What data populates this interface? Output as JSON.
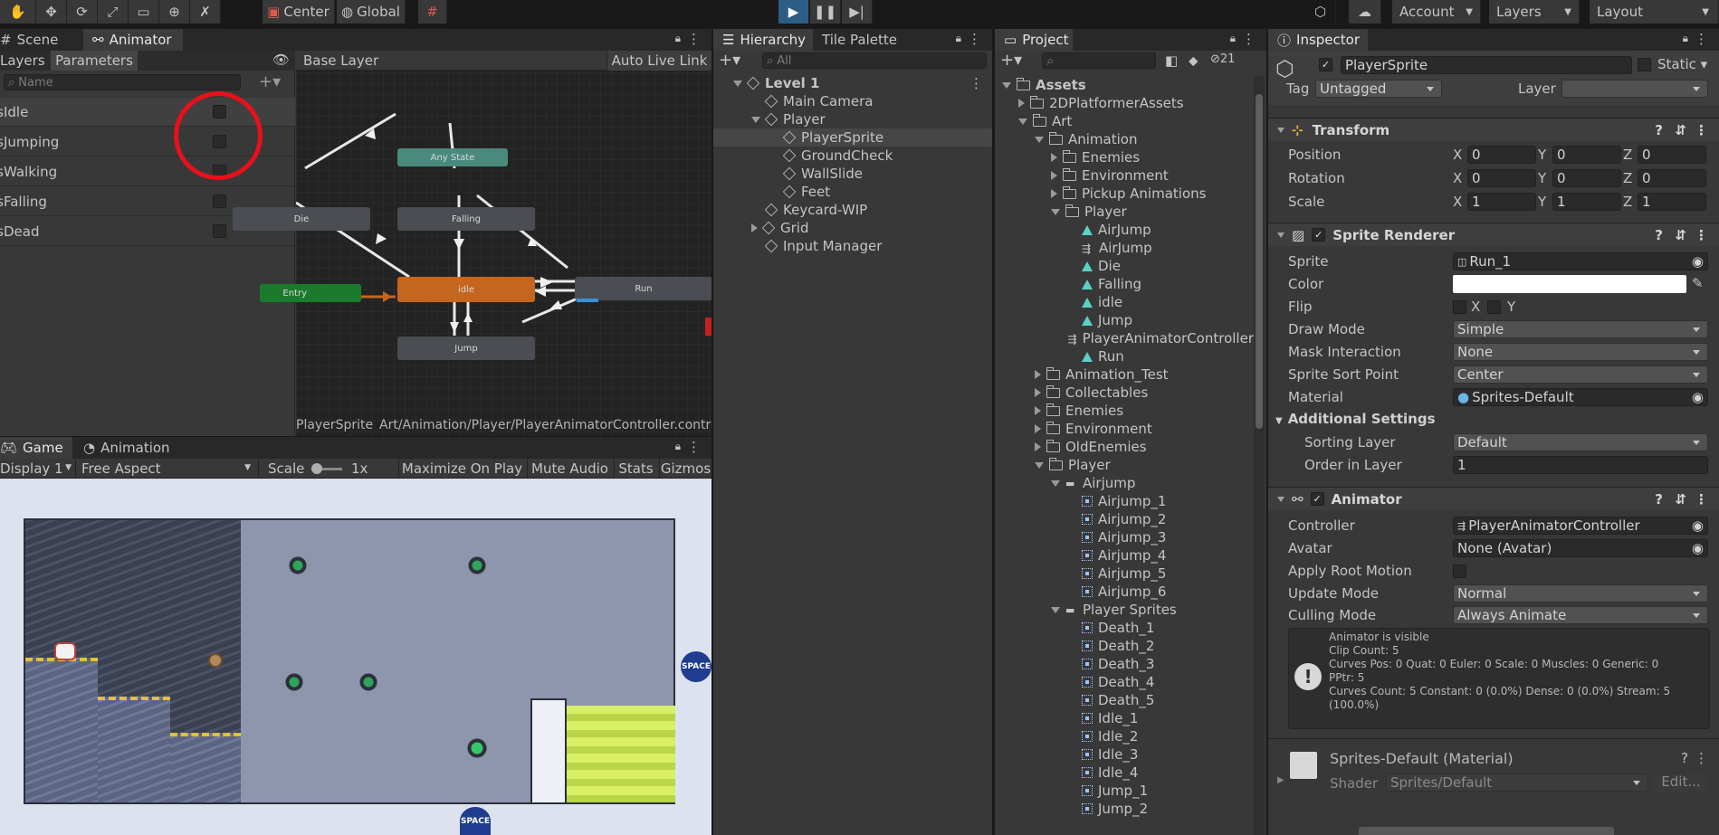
{
  "toolbar": {
    "center_label": "Center",
    "global_label": "Global",
    "account_label": "Account",
    "layers_label": "Layers",
    "layout_label": "Layout"
  },
  "animator": {
    "tab_scene": "Scene",
    "tab_animator": "Animator",
    "tab_layers": "Layers",
    "tab_parameters": "Parameters",
    "base_layer": "Base Layer",
    "auto_live_link": "Auto Live Link",
    "search_placeholder": "Name",
    "params": [
      "isIdle",
      "isJumping",
      "isWalking",
      "isFalling",
      "isDead"
    ],
    "states": {
      "any": "Any State",
      "falling": "Falling",
      "die": "Die",
      "idle": "idle",
      "run": "Run",
      "jump": "Jump",
      "entry": "Entry"
    },
    "footer_object": "PlayerSprite",
    "footer_path": "Art/Animation/Player/PlayerAnimatorController.controller"
  },
  "game": {
    "tab_game": "Game",
    "tab_animation": "Animation",
    "display": "Display 1",
    "aspect": "Free Aspect",
    "scale_label": "Scale",
    "scale_value": "1x",
    "maximize": "Maximize On Play",
    "mute": "Mute Audio",
    "stats": "Stats",
    "gizmos": "Gizmos",
    "space_badge": "SPACE"
  },
  "hierarchy": {
    "tab": "Hierarchy",
    "tab2": "Tile Palette",
    "search_placeholder": "All",
    "items": [
      {
        "label": "Level 1",
        "indent": 0,
        "bold": true
      },
      {
        "label": "Main Camera",
        "indent": 1
      },
      {
        "label": "Player",
        "indent": 1
      },
      {
        "label": "PlayerSprite",
        "indent": 2,
        "selected": true
      },
      {
        "label": "GroundCheck",
        "indent": 2
      },
      {
        "label": "WallSlide",
        "indent": 2
      },
      {
        "label": "Feet",
        "indent": 2
      },
      {
        "label": "Keycard-WIP",
        "indent": 1
      },
      {
        "label": "Grid",
        "indent": 1
      },
      {
        "label": "Input Manager",
        "indent": 1
      }
    ]
  },
  "project": {
    "tab": "Project",
    "badge_count": "21",
    "items": [
      {
        "label": "Assets",
        "indent": 0,
        "type": "folder",
        "open": true,
        "bold": true
      },
      {
        "label": "2DPlatformerAssets",
        "indent": 1,
        "type": "folder"
      },
      {
        "label": "Art",
        "indent": 1,
        "type": "folder",
        "open": true
      },
      {
        "label": "Animation",
        "indent": 2,
        "type": "folder",
        "open": true
      },
      {
        "label": "Enemies",
        "indent": 3,
        "type": "folder"
      },
      {
        "label": "Environment",
        "indent": 3,
        "type": "folder"
      },
      {
        "label": "Pickup Animations",
        "indent": 3,
        "type": "folder"
      },
      {
        "label": "Player",
        "indent": 3,
        "type": "folder",
        "open": true
      },
      {
        "label": "AirJump",
        "indent": 4,
        "type": "clip"
      },
      {
        "label": "AirJump",
        "indent": 4,
        "type": "ctrl"
      },
      {
        "label": "Die",
        "indent": 4,
        "type": "clip"
      },
      {
        "label": "Falling",
        "indent": 4,
        "type": "clip"
      },
      {
        "label": "idle",
        "indent": 4,
        "type": "clip"
      },
      {
        "label": "Jump",
        "indent": 4,
        "type": "clip"
      },
      {
        "label": "PlayerAnimatorController",
        "indent": 4,
        "type": "ctrl"
      },
      {
        "label": "Run",
        "indent": 4,
        "type": "clip"
      },
      {
        "label": "Animation_Test",
        "indent": 2,
        "type": "folder"
      },
      {
        "label": "Collectables",
        "indent": 2,
        "type": "folder"
      },
      {
        "label": "Enemies",
        "indent": 2,
        "type": "folder"
      },
      {
        "label": "Environment",
        "indent": 2,
        "type": "folder"
      },
      {
        "label": "OldEnemies",
        "indent": 2,
        "type": "folder"
      },
      {
        "label": "Player",
        "indent": 2,
        "type": "folder",
        "open": true
      },
      {
        "label": "Airjump",
        "indent": 3,
        "type": "sheet",
        "open": true
      },
      {
        "label": "Airjump_1",
        "indent": 4,
        "type": "frame"
      },
      {
        "label": "Airjump_2",
        "indent": 4,
        "type": "frame"
      },
      {
        "label": "Airjump_3",
        "indent": 4,
        "type": "frame"
      },
      {
        "label": "Airjump_4",
        "indent": 4,
        "type": "frame"
      },
      {
        "label": "Airjump_5",
        "indent": 4,
        "type": "frame"
      },
      {
        "label": "Airjump_6",
        "indent": 4,
        "type": "frame"
      },
      {
        "label": "Player Sprites",
        "indent": 3,
        "type": "sheet",
        "open": true
      },
      {
        "label": "Death_1",
        "indent": 4,
        "type": "frame"
      },
      {
        "label": "Death_2",
        "indent": 4,
        "type": "frame"
      },
      {
        "label": "Death_3",
        "indent": 4,
        "type": "frame"
      },
      {
        "label": "Death_4",
        "indent": 4,
        "type": "frame"
      },
      {
        "label": "Death_5",
        "indent": 4,
        "type": "frame"
      },
      {
        "label": "Idle_1",
        "indent": 4,
        "type": "frame"
      },
      {
        "label": "Idle_2",
        "indent": 4,
        "type": "frame"
      },
      {
        "label": "Idle_3",
        "indent": 4,
        "type": "frame"
      },
      {
        "label": "Idle_4",
        "indent": 4,
        "type": "frame"
      },
      {
        "label": "Jump_1",
        "indent": 4,
        "type": "frame"
      },
      {
        "label": "Jump_2",
        "indent": 4,
        "type": "frame"
      }
    ]
  },
  "inspector": {
    "tab": "Inspector",
    "object_name": "PlayerSprite",
    "static_label": "Static",
    "tag_label": "Tag",
    "tag_value": "Untagged",
    "layer_label": "Layer",
    "transform": {
      "title": "Transform",
      "position_label": "Position",
      "rotation_label": "Rotation",
      "scale_label": "Scale",
      "position": [
        "0",
        "0",
        "0"
      ],
      "rotation": [
        "0",
        "0",
        "0"
      ],
      "scale": [
        "1",
        "1",
        "1"
      ],
      "x": "X",
      "y": "Y",
      "z": "Z"
    },
    "sprite_renderer": {
      "title": "Sprite Renderer",
      "sprite_label": "Sprite",
      "sprite_value": "Run_1",
      "color_label": "Color",
      "flip_label": "Flip",
      "flip_x": "X",
      "flip_y": "Y",
      "draw_mode_label": "Draw Mode",
      "draw_mode": "Simple",
      "mask_label": "Mask Interaction",
      "mask": "None",
      "sort_point_label": "Sprite Sort Point",
      "sort_point": "Center",
      "material_label": "Material",
      "material": "Sprites-Default",
      "additional": "Additional Settings",
      "sorting_layer_label": "Sorting Layer",
      "sorting_layer": "Default",
      "order_label": "Order in Layer",
      "order": "1"
    },
    "animator": {
      "title": "Animator",
      "controller_label": "Controller",
      "controller": "PlayerAnimatorController",
      "avatar_label": "Avatar",
      "avatar": "None (Avatar)",
      "root_motion_label": "Apply Root Motion",
      "update_mode_label": "Update Mode",
      "update_mode": "Normal",
      "culling_label": "Culling Mode",
      "culling": "Always Animate",
      "info": [
        "Animator is visible",
        "Clip Count: 5",
        "Curves Pos: 0 Quat: 0 Euler: 0 Scale: 0 Muscles: 0 Generic: 0",
        "PPtr: 5",
        "Curves Count: 5 Constant: 0 (0.0%) Dense: 0 (0.0%) Stream: 5",
        "(100.0%)"
      ]
    },
    "material": {
      "title": "Sprites-Default (Material)",
      "shader_label": "Shader",
      "shader": "Sprites/Default",
      "edit": "Edit..."
    }
  },
  "colors": {
    "accent_blue": "#2c5d87",
    "selected_row": "#2c5d87",
    "highlight_circle": "#e8101a",
    "idle_state": "#c5661e",
    "any_state": "#4a8a7c",
    "entry_state": "#1c7a2d"
  }
}
